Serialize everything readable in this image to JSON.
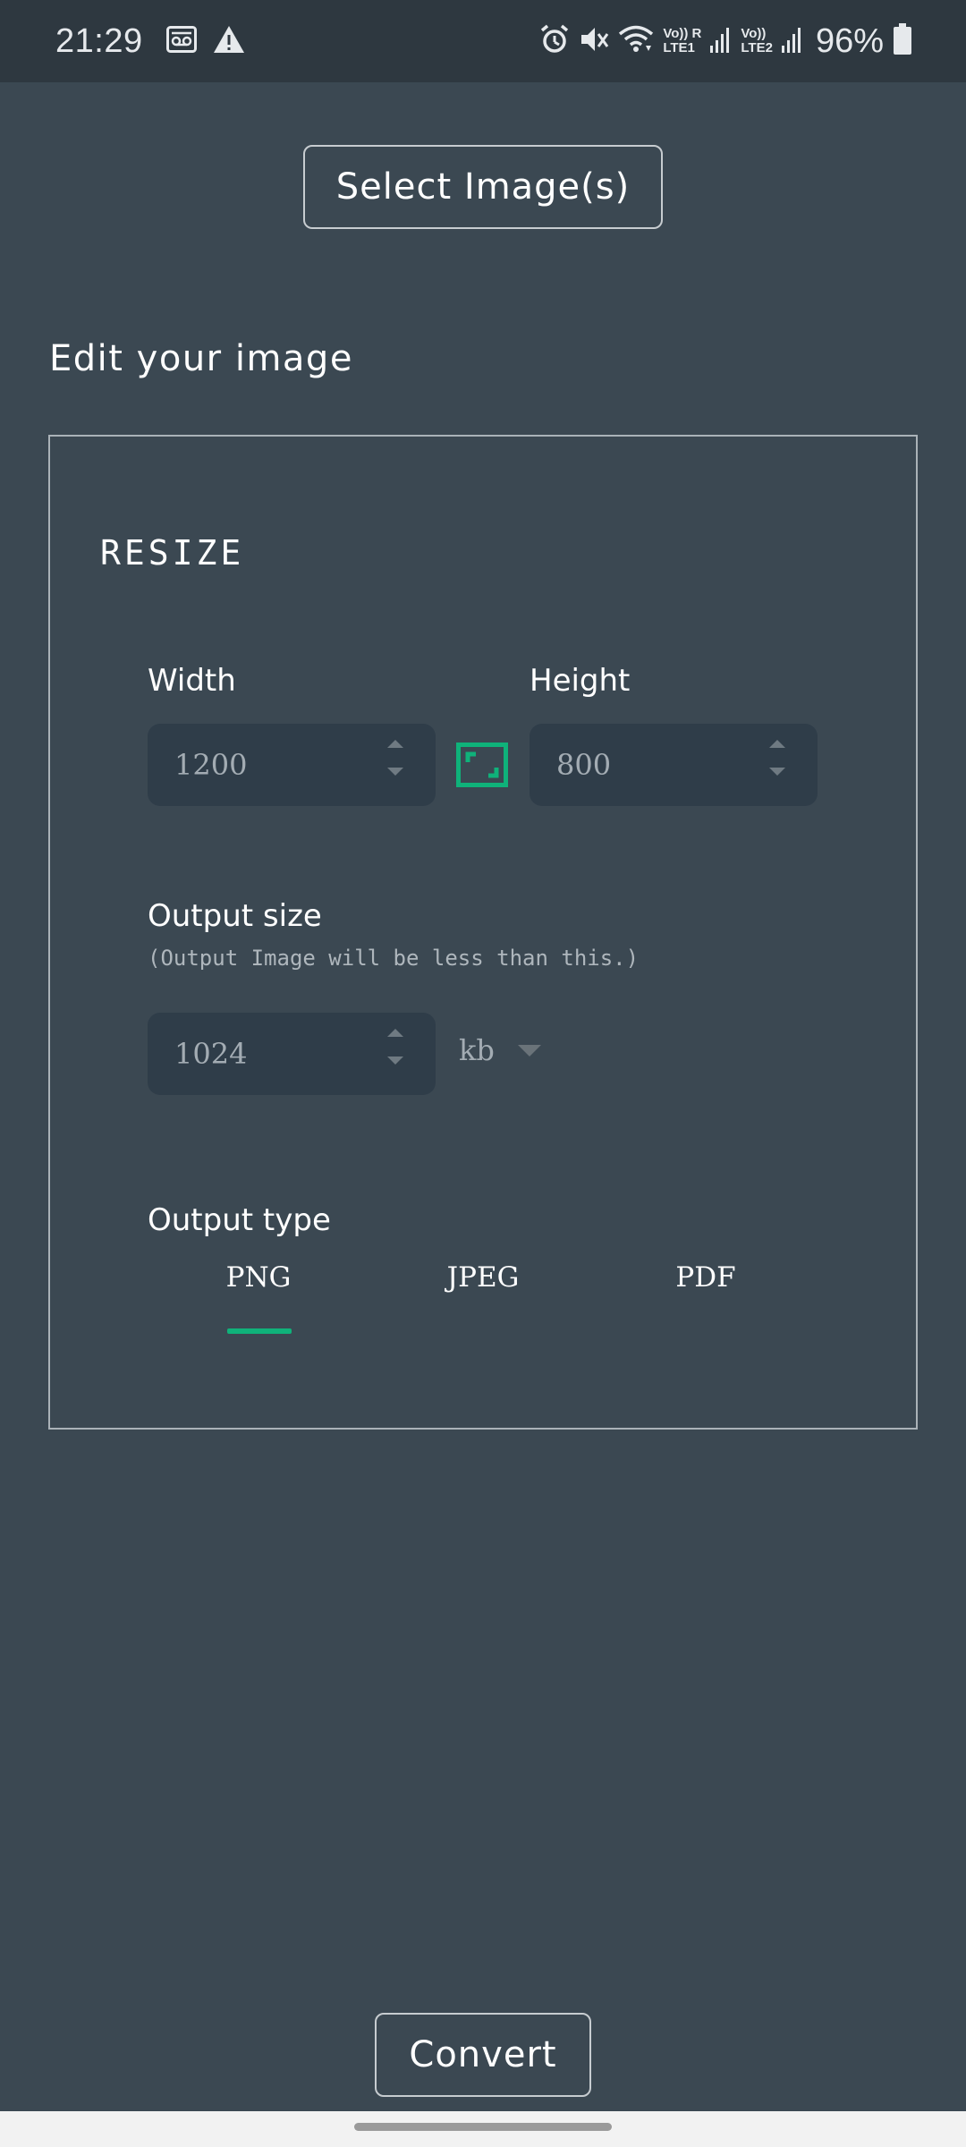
{
  "status_bar": {
    "time": "21:29",
    "left_icons": [
      "voicemail-icon",
      "warning-icon"
    ],
    "right_icons": [
      "alarm-icon",
      "mute-icon",
      "wifi-icon",
      "signal-icon",
      "battery-icon"
    ],
    "sim1_label_top": "Vo))",
    "sim1_label_bottom": "LTE1",
    "sim1_roaming": "R",
    "sim2_label_top": "Vo))",
    "sim2_label_bottom": "LTE2",
    "battery": "96%"
  },
  "select_button": {
    "label": "Select Image(s)"
  },
  "edit_title": "Edit your image",
  "resize": {
    "title": "RESIZE",
    "width_label": "Width",
    "height_label": "Height",
    "width_value": "1200",
    "height_value": "800",
    "aspect_lock_icon": "aspect-ratio-icon"
  },
  "output_size": {
    "label": "Output size",
    "hint": "(Output Image will be less than this.)",
    "value": "1024",
    "unit": "kb"
  },
  "output_type": {
    "label": "Output type",
    "options": [
      "PNG",
      "JPEG",
      "PDF"
    ],
    "selected": "PNG"
  },
  "convert_button": {
    "label": "Convert"
  },
  "colors": {
    "background": "#3b4852",
    "status_bar": "#2e3840",
    "input_bg": "#2f3d49",
    "accent": "#0fb27a",
    "border": "#aab2b8"
  }
}
